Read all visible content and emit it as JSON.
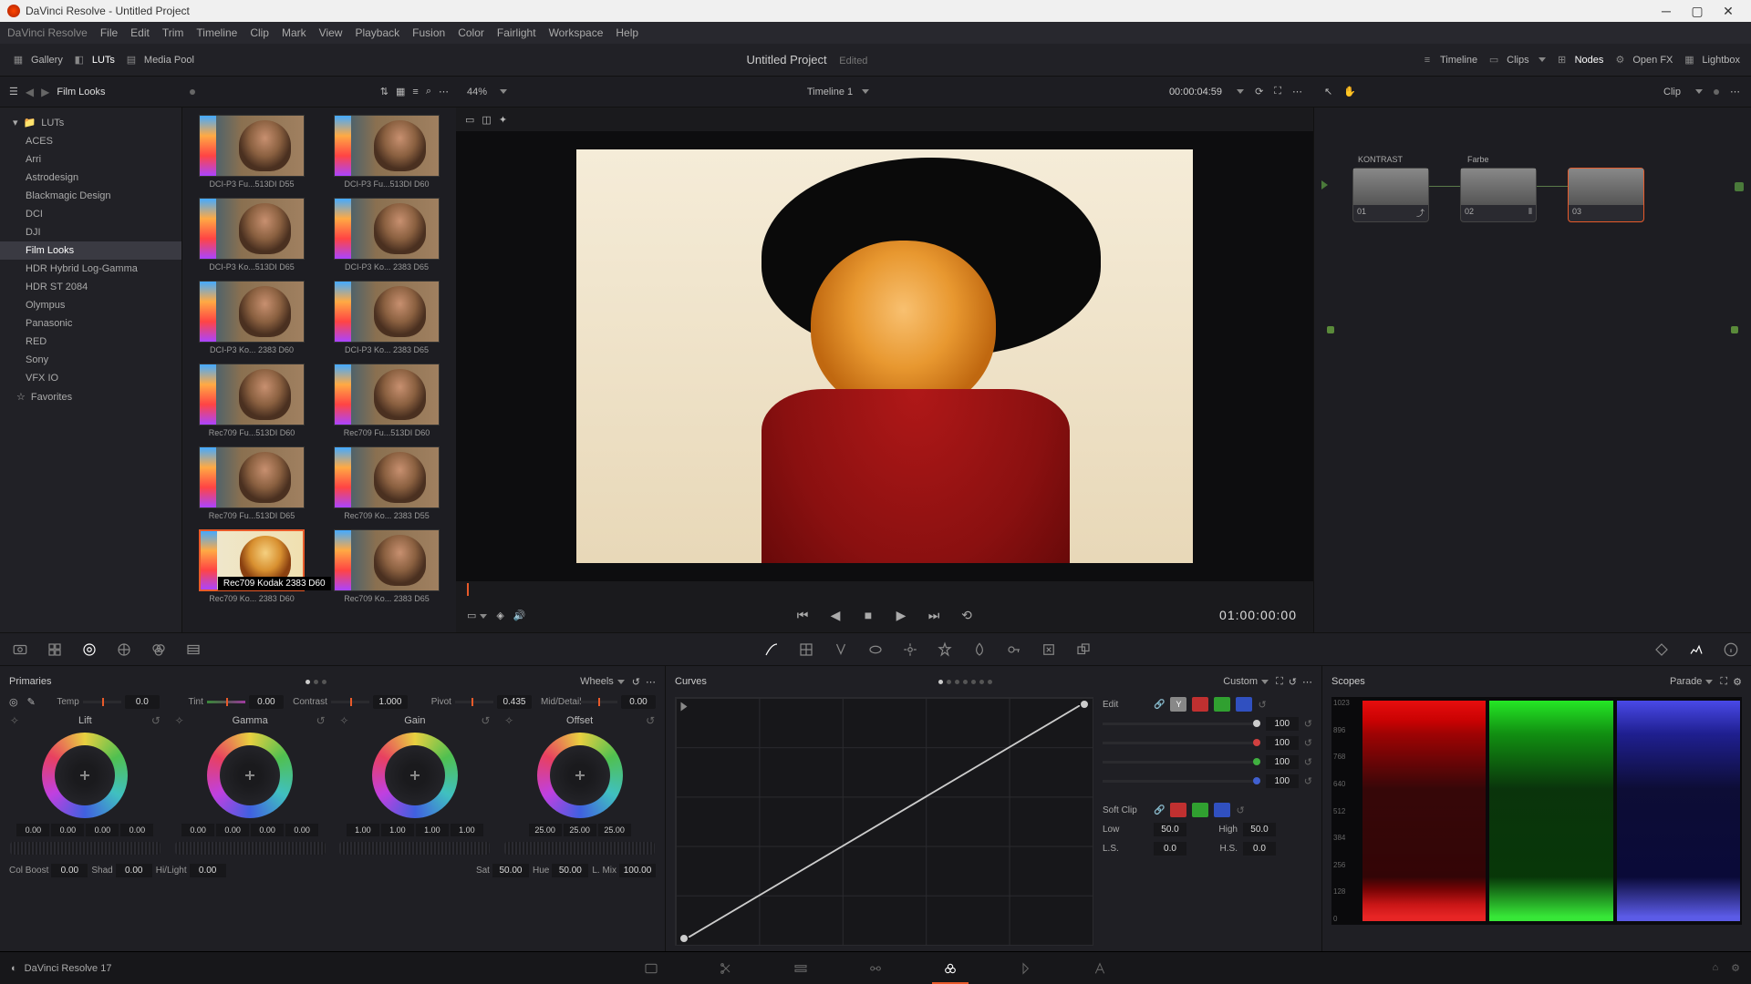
{
  "titlebar": {
    "title": "DaVinci Resolve - Untitled Project"
  },
  "menubar": {
    "logo": "DaVinci Resolve",
    "items": [
      "File",
      "Edit",
      "Trim",
      "Timeline",
      "Clip",
      "Mark",
      "View",
      "Playback",
      "Fusion",
      "Color",
      "Fairlight",
      "Workspace",
      "Help"
    ]
  },
  "toolbar": {
    "gallery": "Gallery",
    "luts": "LUTs",
    "media_pool": "Media Pool",
    "project_title": "Untitled Project",
    "project_status": "Edited",
    "timeline": "Timeline",
    "clips": "Clips",
    "nodes": "Nodes",
    "openfx": "Open FX",
    "lightbox": "Lightbox"
  },
  "secbar": {
    "breadcrumb": "Film Looks",
    "zoom": "44%",
    "timeline_name": "Timeline 1",
    "timecode_src": "00:00:04:59",
    "clip_label": "Clip"
  },
  "luts_tree": {
    "root": "LUTs",
    "items": [
      "ACES",
      "Arri",
      "Astrodesign",
      "Blackmagic Design",
      "DCI",
      "DJI",
      "Film Looks",
      "HDR Hybrid Log-Gamma",
      "HDR ST 2084",
      "Olympus",
      "Panasonic",
      "RED",
      "Sony",
      "VFX IO"
    ],
    "favorites": "Favorites",
    "selected": "Film Looks"
  },
  "luts_grid": {
    "tooltip": "Rec709 Kodak 2383 D60",
    "items": [
      {
        "label": "DCI-P3 Fu...513DI D55"
      },
      {
        "label": "DCI-P3 Fu...513DI D60"
      },
      {
        "label": "DCI-P3 Ko...513DI D65"
      },
      {
        "label": "DCI-P3 Ko... 2383 D65"
      },
      {
        "label": "DCI-P3 Ko... 2383 D60"
      },
      {
        "label": "DCI-P3 Ko... 2383 D65"
      },
      {
        "label": "Rec709 Fu...513DI D60"
      },
      {
        "label": "Rec709 Fu...513DI D60"
      },
      {
        "label": "Rec709 Fu...513DI D65"
      },
      {
        "label": "Rec709 Ko... 2383 D55"
      },
      {
        "label": "Rec709 Ko... 2383 D60"
      },
      {
        "label": "Rec709 Ko... 2383 D65"
      }
    ]
  },
  "viewer": {
    "timecode": "01:00:00:00"
  },
  "nodes": {
    "n1_title": "KONTRAST",
    "n1_num": "01",
    "n2_title": "Farbe",
    "n2_num": "02",
    "n3_num": "03"
  },
  "primaries": {
    "title": "Primaries",
    "mode": "Wheels",
    "temp": {
      "label": "Temp",
      "value": "0.0"
    },
    "tint": {
      "label": "Tint",
      "value": "0.00"
    },
    "contrast": {
      "label": "Contrast",
      "value": "1.000"
    },
    "pivot": {
      "label": "Pivot",
      "value": "0.435"
    },
    "middetail": {
      "label": "Mid/Detail",
      "value": "0.00"
    },
    "wheels": {
      "lift": {
        "label": "Lift",
        "vals": [
          "0.00",
          "0.00",
          "0.00",
          "0.00"
        ]
      },
      "gamma": {
        "label": "Gamma",
        "vals": [
          "0.00",
          "0.00",
          "0.00",
          "0.00"
        ]
      },
      "gain": {
        "label": "Gain",
        "vals": [
          "1.00",
          "1.00",
          "1.00",
          "1.00"
        ]
      },
      "offset": {
        "label": "Offset",
        "vals": [
          "25.00",
          "25.00",
          "25.00"
        ]
      }
    },
    "bottom": {
      "colboost": {
        "label": "Col Boost",
        "value": "0.00"
      },
      "shad": {
        "label": "Shad",
        "value": "0.00"
      },
      "hilight": {
        "label": "Hi/Light",
        "value": "0.00"
      },
      "sat": {
        "label": "Sat",
        "value": "50.00"
      },
      "hue": {
        "label": "Hue",
        "value": "50.00"
      },
      "lmix": {
        "label": "L. Mix",
        "value": "100.00"
      }
    }
  },
  "curves": {
    "title": "Curves",
    "mode": "Custom",
    "edit_label": "Edit",
    "chan_vals": [
      "100",
      "100",
      "100",
      "100"
    ],
    "softclip": "Soft Clip",
    "low": {
      "label": "Low",
      "value": "50.0"
    },
    "high": {
      "label": "High",
      "value": "50.0"
    },
    "ls": {
      "label": "L.S.",
      "value": "0.0"
    },
    "hs": {
      "label": "H.S.",
      "value": "0.0"
    }
  },
  "scopes": {
    "title": "Scopes",
    "mode": "Parade",
    "axis": [
      "1023",
      "896",
      "768",
      "640",
      "512",
      "384",
      "256",
      "128",
      "0"
    ]
  },
  "footer": {
    "app": "DaVinci Resolve 17"
  }
}
